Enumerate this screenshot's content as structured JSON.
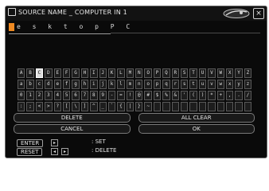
{
  "window": {
    "title": "SOURCE NAME _ COMPUTER IN 1",
    "close_glyph": "×"
  },
  "input": {
    "value": "e s k t o p   P C"
  },
  "keyboard": {
    "rows": [
      [
        "A",
        "B",
        "C",
        "D",
        "E",
        "F",
        "G",
        "H",
        "I",
        "J",
        "K",
        "L",
        "M",
        "N",
        "O",
        "P",
        "Q",
        "R",
        "S",
        "T",
        "U",
        "V",
        "W",
        "X",
        "Y",
        "Z"
      ],
      [
        "a",
        "b",
        "c",
        "d",
        "e",
        "f",
        "g",
        "h",
        "i",
        "j",
        "k",
        "l",
        "m",
        "n",
        "o",
        "p",
        "q",
        "r",
        "s",
        "t",
        "u",
        "v",
        "w",
        "x",
        "y",
        "z"
      ],
      [
        "0",
        "1",
        "2",
        "3",
        "4",
        "5",
        "6",
        "7",
        "8",
        "9",
        "-",
        "=",
        "!",
        "@",
        "#",
        "$",
        "%",
        "&",
        "'",
        "(",
        ")",
        "*",
        "+",
        ",",
        ".",
        "/"
      ],
      [
        ":",
        ";",
        "<",
        ">",
        "?",
        "[",
        "\\",
        "]",
        "^",
        "_",
        "`",
        "{",
        "|",
        "}",
        "~",
        " ",
        " ",
        " ",
        " ",
        " ",
        " ",
        " ",
        " ",
        " ",
        " ",
        " "
      ]
    ],
    "selected": "C"
  },
  "actions": {
    "delete_label": "DELETE",
    "all_clear_label": "ALL CLEAR",
    "cancel_label": "CANCEL",
    "ok_label": "OK"
  },
  "legend": {
    "enter_label": "ENTER",
    "reset_label": "RESET",
    "set_text": ": SET",
    "delete_text": ": DELETE",
    "right_glyph": "▸",
    "left_glyph": "◂"
  }
}
